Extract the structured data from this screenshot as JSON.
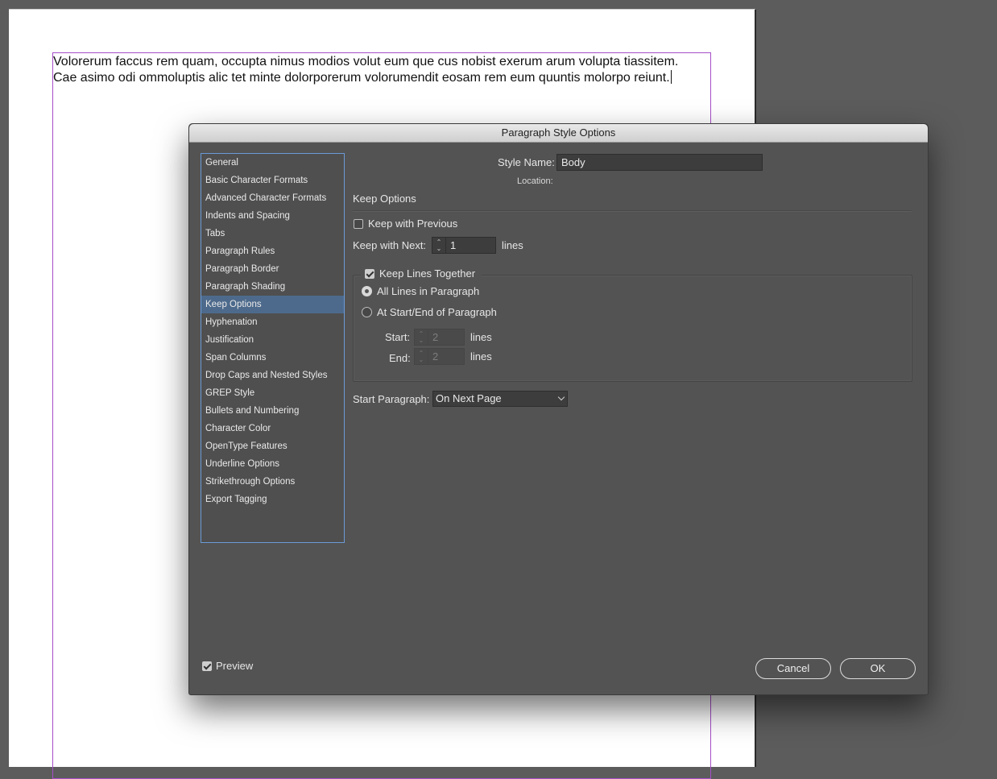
{
  "document": {
    "body_text": "Volorerum faccus rem quam, occupta nimus modios volut eum que cus nobist exerum arum volupta tiassitem. Cae asimo odi ommoluptis alic tet minte dolorporerum volorumendit eosam rem eum quuntis molorpo reiunt."
  },
  "dialog": {
    "title": "Paragraph Style Options",
    "categories": [
      "General",
      "Basic Character Formats",
      "Advanced Character Formats",
      "Indents and Spacing",
      "Tabs",
      "Paragraph Rules",
      "Paragraph Border",
      "Paragraph Shading",
      "Keep Options",
      "Hyphenation",
      "Justification",
      "Span Columns",
      "Drop Caps and Nested Styles",
      "GREP Style",
      "Bullets and Numbering",
      "Character Color",
      "OpenType Features",
      "Underline Options",
      "Strikethrough Options",
      "Export Tagging"
    ],
    "selected_category": "Keep Options",
    "style_name_label": "Style Name:",
    "style_name_value": "Body",
    "location_label": "Location:",
    "section_title": "Keep Options",
    "keep_with_previous_label": "Keep with Previous",
    "keep_with_previous_checked": false,
    "keep_with_next_label": "Keep with Next:",
    "keep_with_next_value": "1",
    "keep_with_next_unit": "lines",
    "keep_lines_together_label": "Keep Lines Together",
    "keep_lines_together_checked": true,
    "all_lines_label": "All Lines in Paragraph",
    "start_end_label": "At Start/End of Paragraph",
    "selected_radio": "All Lines in Paragraph",
    "start_label": "Start:",
    "start_value": "2",
    "start_unit": "lines",
    "end_label": "End:",
    "end_value": "2",
    "end_unit": "lines",
    "start_paragraph_label": "Start Paragraph:",
    "start_paragraph_value": "On Next Page",
    "preview_label": "Preview",
    "preview_checked": true,
    "cancel_label": "Cancel",
    "ok_label": "OK"
  },
  "colors": {
    "selection": "#4d6a8c",
    "list_border": "#6a9ad6",
    "frame": "#a64dc9"
  }
}
